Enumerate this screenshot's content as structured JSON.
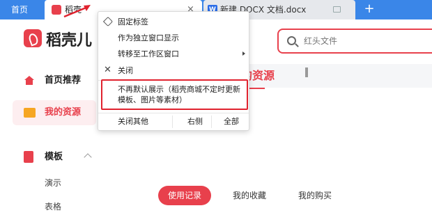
{
  "tabs": {
    "home": "首页",
    "active": {
      "title": "稻壳",
      "close": "×"
    },
    "doc": {
      "badge": "W",
      "title": "新建 DOCX 文档.docx"
    },
    "add": "+"
  },
  "header": {
    "brand": "稻壳儿",
    "search_placeholder": "红头文件"
  },
  "sidebar": {
    "items": [
      {
        "label": "首页推荐",
        "icon": "home-icon"
      },
      {
        "label": "我的资源",
        "icon": "folder-icon",
        "active": true
      },
      {
        "label": "模板",
        "icon": "template-icon"
      }
    ],
    "sub_items": [
      "演示",
      "表格"
    ]
  },
  "main": {
    "title": "我的资源",
    "filters": [
      "使用记录",
      "我的收藏",
      "我的购买"
    ],
    "active_filter": "使用记录"
  },
  "context_menu": {
    "items": [
      {
        "label": "固定标签",
        "icon": "pin-icon"
      },
      {
        "label": "作为独立窗口显示"
      },
      {
        "label": "转移至工作区窗口",
        "submenu": true
      },
      {
        "label": "关闭",
        "icon": "close-icon"
      }
    ],
    "highlighted": "不再默认展示（稻壳商城不定时更新模板、图片等素材）",
    "bottom": [
      "关闭其他",
      "右侧",
      "全部"
    ]
  },
  "colors": {
    "brand_red": "#e8404c",
    "tab_bar_blue": "#3a86e8",
    "annotation_red": "#e0222e"
  }
}
